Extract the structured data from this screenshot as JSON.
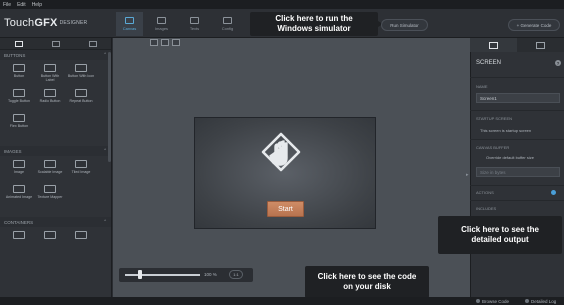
{
  "menu": [
    "File",
    "Edit",
    "Help"
  ],
  "app": {
    "name_main": "Touch",
    "name_gfx": "GFX",
    "name_sub": "DESIGNER"
  },
  "topnav": [
    {
      "label": "Canvas",
      "icon": "canvas-icon"
    },
    {
      "label": "Images",
      "icon": "images-icon"
    },
    {
      "label": "Texts",
      "icon": "texts-icon"
    },
    {
      "label": "Config",
      "icon": "config-icon"
    }
  ],
  "top_buttons": {
    "run_simulator": "Run Simulator",
    "generate_code": "+ Generate Code"
  },
  "callouts": {
    "simulator": "Click here to run the Windows simulator",
    "detailed": "Click here to see the detailed output",
    "code": "Click here to see the code on your disk"
  },
  "left_panel": {
    "buttons_section": "BUTTONS",
    "buttons": [
      "Button",
      "Button With Label",
      "Button With Icon",
      "Toggle Button",
      "Radio Button",
      "Repeat Button",
      "Flex Button"
    ],
    "images_section": "IMAGES",
    "images": [
      "Image",
      "Scalable Image",
      "Tiled Image",
      "Animated Image",
      "Texture Mapper"
    ],
    "containers_section": "CONTAINERS"
  },
  "canvas": {
    "start_label": "Start",
    "zoom": "100 %",
    "fit": "1:1"
  },
  "right_panel": {
    "title": "SCREEN",
    "name_label": "NAME",
    "name_value": "Screen1",
    "startup_label": "STARTUP SCREEN",
    "startup_text": "This screen is startup screen",
    "buffer_label": "CANVAS BUFFER",
    "buffer_text": "Override default buffer size",
    "buffer_placeholder": "Size in bytes",
    "actions_label": "ACTIONS",
    "includes_label": "INCLUDES"
  },
  "status": {
    "browse_code": "Browse Code",
    "detailed_log": "Detailed Log"
  },
  "colors": {
    "accent": "#5aa9d6",
    "start_button": "#c27d58",
    "callout_bg": "#1f2124"
  }
}
